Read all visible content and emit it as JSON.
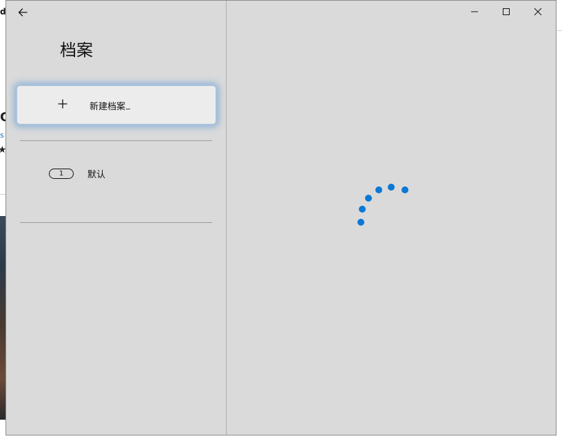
{
  "background_app": {
    "top_char": "d",
    "heading_char": "C",
    "link_char": "s",
    "star_glyph": "★"
  },
  "window": {
    "back_icon": "arrow-left-icon",
    "title": "档案",
    "new_profile": {
      "icon": "plus-icon",
      "label": "新建档案"
    },
    "profiles": [
      {
        "badge": "1",
        "name": "默认"
      }
    ],
    "caption_buttons": {
      "minimize_icon": "minimize-icon",
      "maximize_icon": "maximize-icon",
      "close_icon": "close-icon"
    },
    "loading_indicator": "progress-ring",
    "accent_color": "#0a78d4",
    "pane_background": "#dadada"
  }
}
